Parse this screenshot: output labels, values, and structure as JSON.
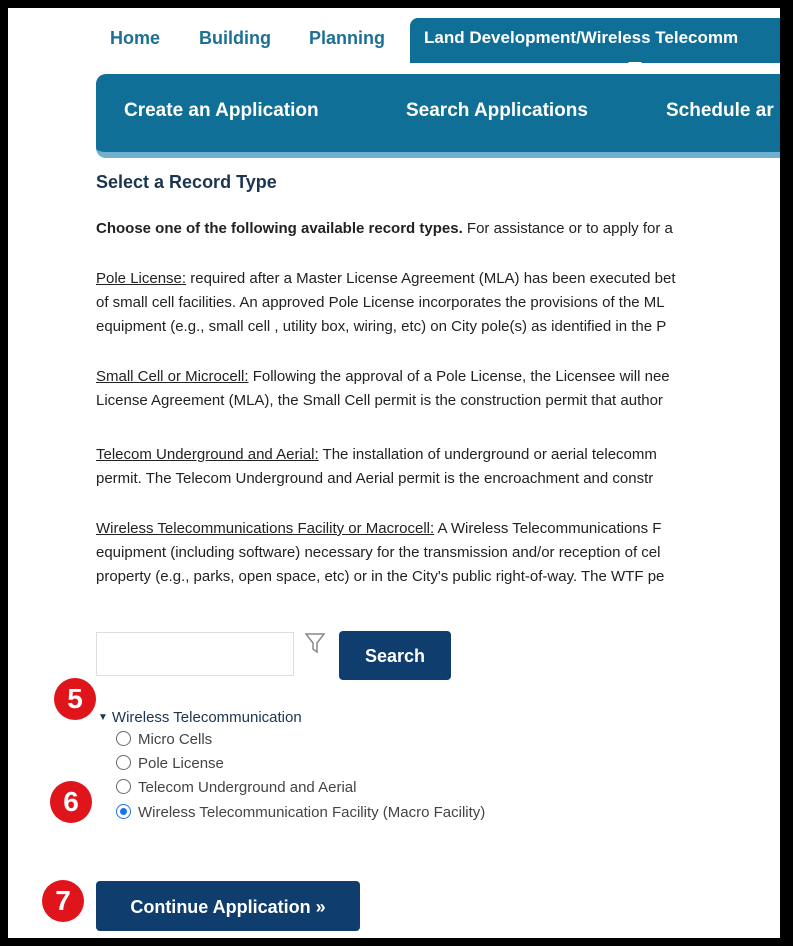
{
  "top_tabs": [
    {
      "label": "Home"
    },
    {
      "label": "Building"
    },
    {
      "label": "Planning"
    },
    {
      "label": "Land Development/Wireless Telecomm"
    }
  ],
  "subnav": [
    {
      "label": "Create an Application"
    },
    {
      "label": "Search Applications"
    },
    {
      "label": "Schedule ar"
    }
  ],
  "section_title": "Select a Record Type",
  "intro": {
    "bold": "Choose one of the following available record types.",
    "rest": " For assistance or to apply for a"
  },
  "pole_license": {
    "term": "Pole License:",
    "line1": " required after a Master License Agreement (MLA) has been executed bet",
    "line2": "of small cell facilities.  An approved Pole License incorporates the provisions of the ML",
    "line3": "equipment (e.g., small cell , utility box, wiring, etc) on City pole(s) as identified in the P"
  },
  "small_cell": {
    "term": "Small Cell or Microcell:",
    "line1": " Following the approval of a Pole License, the Licensee will nee",
    "line2": "License Agreement (MLA), the Small Cell permit is the construction permit that author"
  },
  "telecom": {
    "term": "Telecom Underground and Aerial:",
    "line1": " The installation of underground or aerial telecomm",
    "line2": "permit.  The Telecom Underground and Aerial permit is the encroachment and constr"
  },
  "wtf": {
    "term": "Wireless Telecommunications Facility or Macrocell:",
    "line1": " A Wireless Telecommunications F",
    "line2": "equipment (including software) necessary for the transmission and/or reception of cel",
    "line3": "property (e.g., parks, open space, etc) or in the City's public right-of-way.  The WTF pe"
  },
  "search": {
    "placeholder": "",
    "button": "Search",
    "filter_icon": "funnel-icon"
  },
  "badges": {
    "b5": "5",
    "b6": "6",
    "b7": "7"
  },
  "tree": {
    "header": "Wireless Telecommunication",
    "options": [
      {
        "label": "Micro Cells",
        "checked": false
      },
      {
        "label": "Pole License",
        "checked": false
      },
      {
        "label": "Telecom Underground and Aerial",
        "checked": false
      },
      {
        "label": "Wireless Telecommunication Facility (Macro Facility)",
        "checked": true
      }
    ]
  },
  "continue_button": "Continue Application »",
  "colors": {
    "nav": "#0f6f97",
    "button": "#0f3d6d",
    "badge": "#e0141b"
  }
}
